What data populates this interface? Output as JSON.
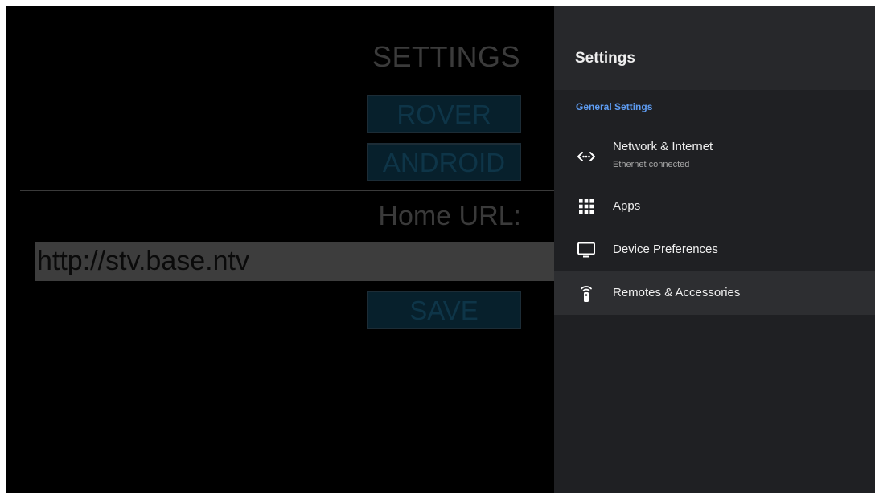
{
  "background_app": {
    "title": "SETTINGS",
    "buttons": {
      "rover": "ROVER",
      "android": "ANDROID",
      "save": "SAVE"
    },
    "home_url_label": "Home URL:",
    "home_url_value": "http://stv.base.ntv"
  },
  "settings_panel": {
    "title": "Settings",
    "section_header": "General Settings",
    "items": [
      {
        "label": "Network & Internet",
        "sublabel": "Ethernet connected",
        "icon": "network-icon"
      },
      {
        "label": "Apps",
        "icon": "apps-grid-icon"
      },
      {
        "label": "Device Preferences",
        "icon": "tv-monitor-icon"
      },
      {
        "label": "Remotes & Accessories",
        "icon": "remote-icon",
        "selected": true
      }
    ]
  },
  "colors": {
    "panel_background": "#1f2023",
    "panel_header": "#27282b",
    "section_accent": "#5e9cf2",
    "selected_row": "#2d2e31"
  }
}
